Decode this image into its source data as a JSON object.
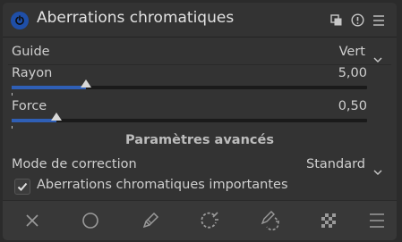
{
  "module": {
    "title": "Aberrations chromatiques",
    "enabled": true
  },
  "header_icons": [
    "presets-icon",
    "reset-icon",
    "menu-icon"
  ],
  "guide": {
    "label": "Guide",
    "value": "Vert"
  },
  "rayon": {
    "label": "Rayon",
    "value": "5,00",
    "level": 0.21
  },
  "force": {
    "label": "Force",
    "value": "0,50",
    "level": 0.125
  },
  "advanced": {
    "title": "Paramètres avancés"
  },
  "mode": {
    "label": "Mode de correction",
    "value": "Standard"
  },
  "important": {
    "label": "Aberrations chromatiques importantes",
    "checked": true
  },
  "toolbar": [
    "close-icon",
    "circle-mask-icon",
    "pencil-icon",
    "parametric-mask-icon",
    "drawn-parametric-mask-icon",
    "raster-mask-icon",
    "mask-menu-icon"
  ],
  "colors": {
    "accent": "#2f5fb6",
    "power": "#1f4fa8",
    "panel": "#333333",
    "text": "#cfcfcf"
  }
}
